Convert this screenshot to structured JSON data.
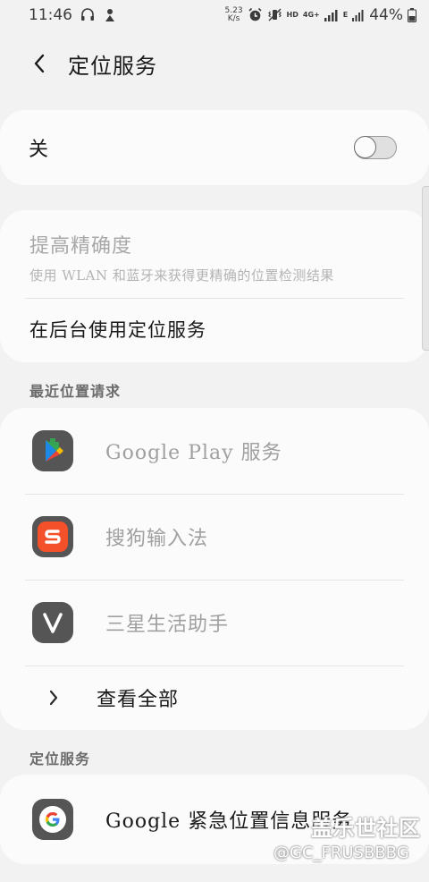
{
  "status_bar": {
    "time": "11:46",
    "net_speed_value": "5.23",
    "net_speed_unit": "K/s",
    "hd_label": "HD",
    "network_4g": "4G+",
    "network_e": "E",
    "battery": "44%",
    "icons": [
      "headset-icon",
      "app-notification-icon",
      "alarm-icon",
      "vibrate-icon",
      "mute-icon",
      "signal-icon",
      "battery-icon"
    ]
  },
  "header": {
    "title": "定位服务",
    "back_icon": "chevron-left-icon"
  },
  "master_toggle": {
    "label": "关",
    "state": "off"
  },
  "settings": {
    "accuracy_title": "提高精确度",
    "accuracy_subtitle": "使用 WLAN 和蓝牙来获得更精确的位置检测结果",
    "background_label": "在后台使用定位服务"
  },
  "recent": {
    "section_title": "最近位置请求",
    "apps": [
      {
        "label": "Google Play 服务",
        "icon": "google-play-services-icon"
      },
      {
        "label": "搜狗输入法",
        "icon": "sogou-input-icon"
      },
      {
        "label": "三星生活助手",
        "icon": "samsung-life-assistant-icon"
      }
    ],
    "view_all": "查看全部"
  },
  "services": {
    "section_title": "定位服务",
    "items": [
      {
        "label": "Google 紧急位置信息服务",
        "icon": "google-icon"
      }
    ]
  },
  "watermark": {
    "main": "盖乐世社区",
    "sub": "@GC_FRUSBBBG"
  },
  "colors": {
    "background": "#f2f2f2",
    "card": "#fbfbfb",
    "disabled_text": "#a0a0a0",
    "sogou_orange": "#f4502a"
  }
}
